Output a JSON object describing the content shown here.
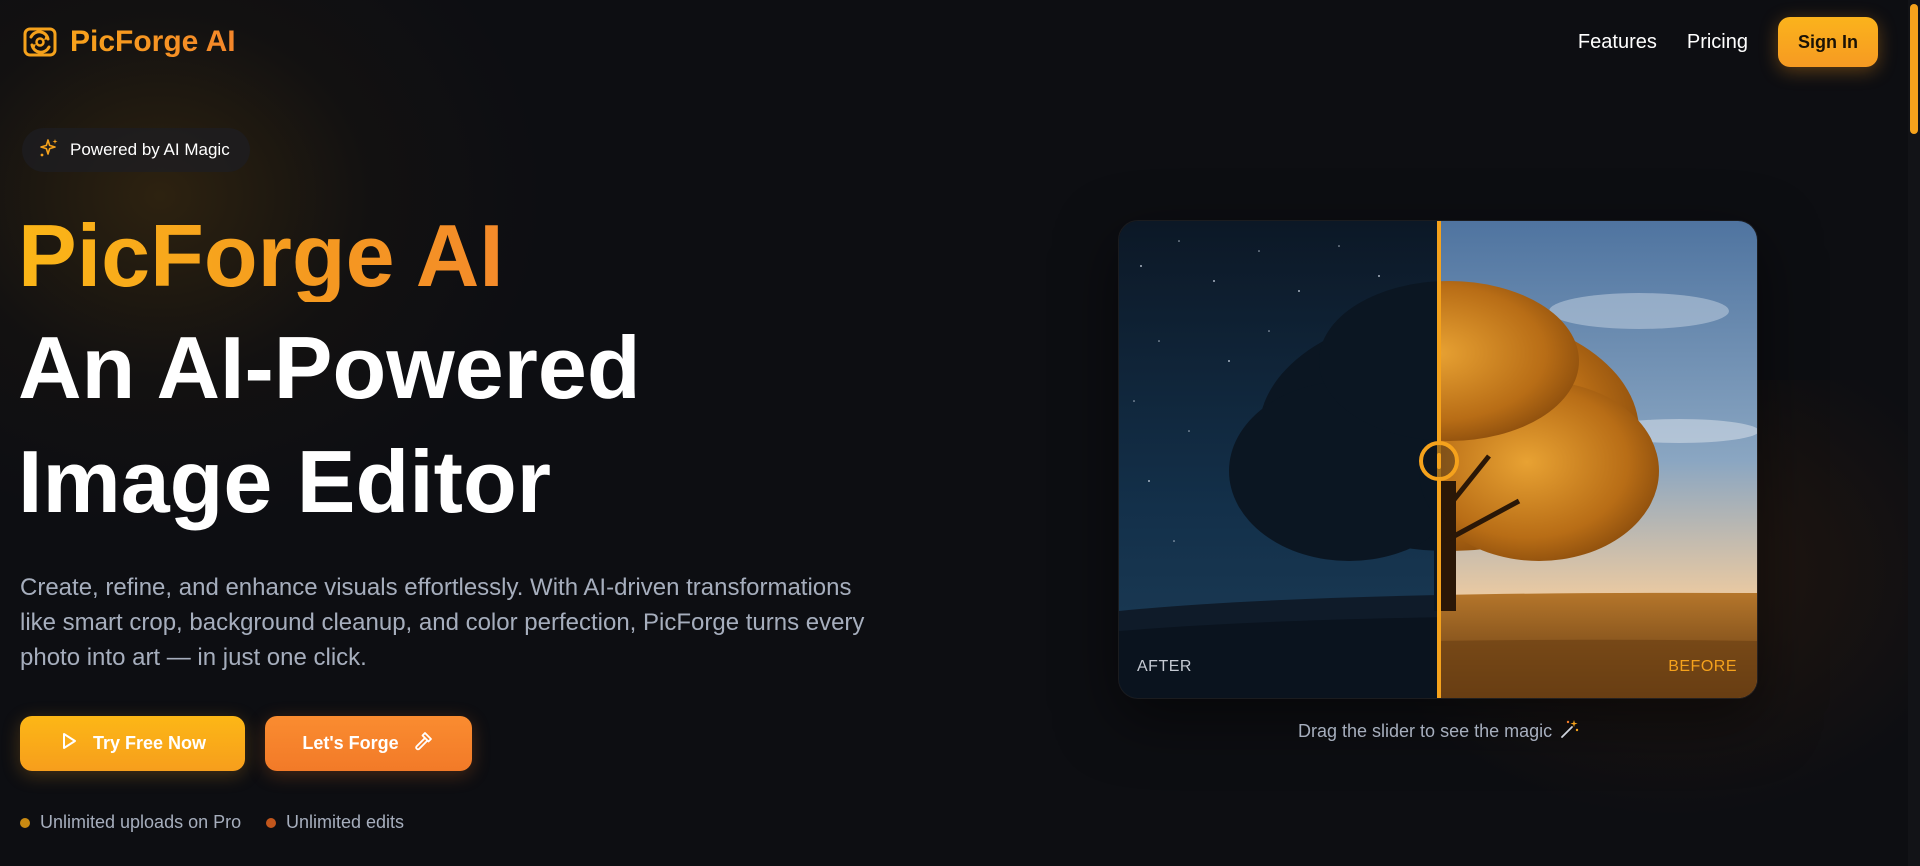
{
  "colors": {
    "accent": "#f5a21c",
    "accent2": "#f27a28",
    "background": "#0d0e12",
    "muted": "#a6aebd"
  },
  "nav": {
    "brand": "PicForge AI",
    "brand_icon": "refresh-image-icon",
    "links": [
      "Features",
      "Pricing"
    ],
    "signin_label": "Sign In"
  },
  "badge": {
    "icon": "sparkles-icon",
    "label": "Powered by AI Magic"
  },
  "hero": {
    "brand": "PicForge AI",
    "line1": "An AI-Powered",
    "line2": "Image Editor",
    "description": "Create, refine, and enhance visuals effortlessly. With AI-driven transformations like smart crop, background cleanup, and color perfection, PicForge turns every photo into art — in just one click."
  },
  "cta": {
    "try_label": "Try Free Now",
    "try_icon": "play-icon",
    "forge_label": "Let's Forge",
    "forge_icon": "hammer-icon"
  },
  "features": [
    {
      "label": "Unlimited uploads on Pro",
      "color": "#c98a12"
    },
    {
      "label": "Unlimited edits",
      "color": "#c2561c"
    }
  ],
  "comparison": {
    "after_label": "AFTER",
    "before_label": "BEFORE",
    "slider_position": 0.5,
    "caption": "Drag the slider to see the magic",
    "caption_icon": "magic-wand-icon"
  }
}
